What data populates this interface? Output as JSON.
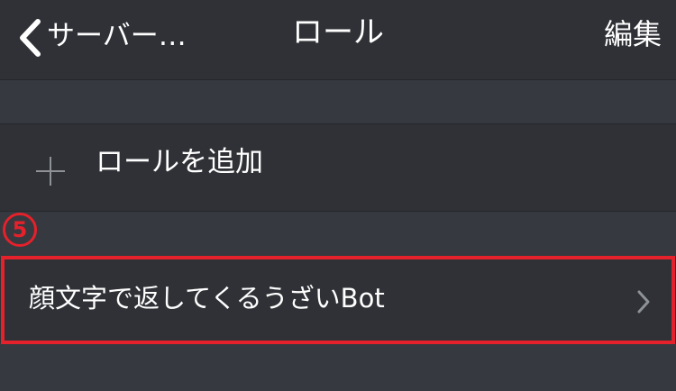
{
  "nav": {
    "back_label": "サーバー…",
    "title": "ロール",
    "edit_label": "編集"
  },
  "add_role": {
    "label": "ロールを追加",
    "icon": "plus-icon"
  },
  "annotation": {
    "step_number": "5",
    "color": "#e5212b"
  },
  "roles": [
    {
      "name": "顔文字で返してくるうざいBot",
      "icon": "chevron-right-icon"
    }
  ],
  "colors": {
    "background": "#36393f",
    "row": "#2f3136",
    "text": "#ffffff",
    "icon": "#8e9297"
  }
}
